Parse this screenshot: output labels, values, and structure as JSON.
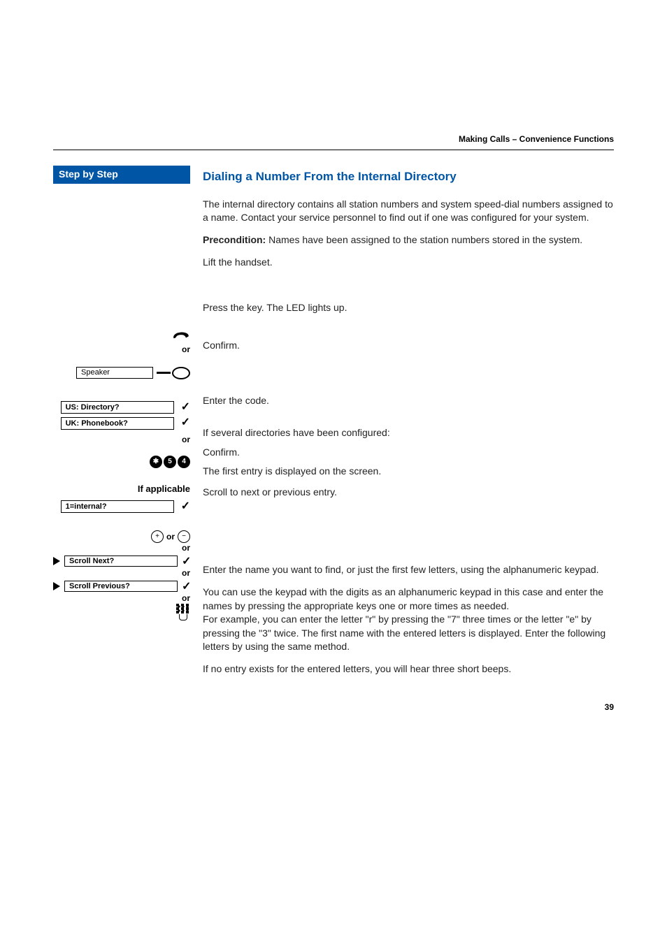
{
  "header": {
    "section_title": "Making Calls – Convenience Functions"
  },
  "sidebar": {
    "title": "Step by Step",
    "speaker_key": "Speaker",
    "directory_us": "US: Directory?",
    "directory_uk": "UK: Phonebook?",
    "or": "or",
    "if_applicable": "If applicable",
    "internal_option": "1=internal?",
    "plus_or_minus": "or",
    "scroll_next": "Scroll Next?",
    "scroll_prev": "Scroll Previous?",
    "code_keys": [
      "✱",
      "5",
      "4"
    ]
  },
  "main": {
    "heading": "Dialing a Number From the Internal Directory",
    "p1": "The internal directory contains all station numbers and system speed-dial numbers assigned to a name. Contact your service personnel to find out if one was configured for your system.",
    "precond_label": "Precondition:",
    "precond_text": " Names have been assigned to the station numbers stored in the system.",
    "lift_handset": "Lift the handset.",
    "press_key": "Press the key. The LED lights up.",
    "confirm": "Confirm.",
    "enter_code": "Enter the code.",
    "if_several": "If several directories have been configured:",
    "confirm2": "Confirm.",
    "first_entry": "The first entry is displayed on the screen.",
    "scroll": "Scroll to next or previous entry.",
    "enter_name": "Enter the name you want to find, or just the first few letters, using the alphanumeric keypad.",
    "keypad_explain": "You can use the keypad with the digits as an alphanumeric keypad in this case and enter the names by pressing the appropriate keys one or more times as needed.\nFor example, you can enter the letter \"r\" by pressing the \"7\" three times or the letter \"e\" by pressing the \"3\" twice. The first name with the entered letters is displayed. Enter the following letters by using the same method.",
    "no_entry": "If no entry exists for the entered letters, you will hear three short beeps."
  },
  "page_number": "39"
}
